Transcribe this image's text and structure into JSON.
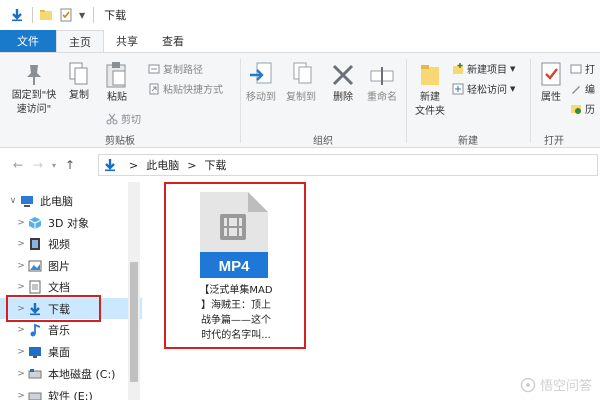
{
  "window": {
    "title": "下载"
  },
  "tabs": [
    {
      "label": "文件"
    },
    {
      "label": "主页"
    },
    {
      "label": "共享"
    },
    {
      "label": "查看"
    }
  ],
  "ribbon": {
    "clipboard": {
      "label": "剪贴板",
      "pin_line1": "固定到\"快",
      "pin_line2": "速访问\"",
      "copy": "复制",
      "paste": "粘贴",
      "copy_path": "复制路径",
      "paste_shortcut": "粘贴快捷方式",
      "cut": "剪切"
    },
    "organize": {
      "label": "组织",
      "move_to": "移动到",
      "copy_to": "复制到",
      "delete": "删除",
      "rename": "重命名"
    },
    "new": {
      "label": "新建",
      "new_folder_line1": "新建",
      "new_folder_line2": "文件夹",
      "new_item": "新建项目",
      "easy_access": "轻松访问"
    },
    "open": {
      "label": "打开",
      "properties": "属性",
      "partial1": "打",
      "partial2": "编",
      "partial3": "历"
    }
  },
  "address": {
    "crumbs": [
      "此电脑",
      "下载"
    ]
  },
  "nav_tree": [
    {
      "label": "此电脑"
    },
    {
      "label": "3D 对象"
    },
    {
      "label": "视频"
    },
    {
      "label": "图片"
    },
    {
      "label": "文档"
    },
    {
      "label": "下载"
    },
    {
      "label": "音乐"
    },
    {
      "label": "桌面"
    },
    {
      "label": "本地磁盘 (C:)"
    },
    {
      "label": "软件 (E:)"
    }
  ],
  "file": {
    "badge": "MP4",
    "name_line1": "【泛式单集MAD",
    "name_line2": "】海贼王：顶上",
    "name_line3": "战争篇——这个",
    "name_line4": "时代的名字叫..."
  },
  "watermark": {
    "text": "悟空问答"
  },
  "colors": {
    "accent": "#1979ca",
    "selection": "#cce8ff",
    "highlight": "#d5201f"
  }
}
